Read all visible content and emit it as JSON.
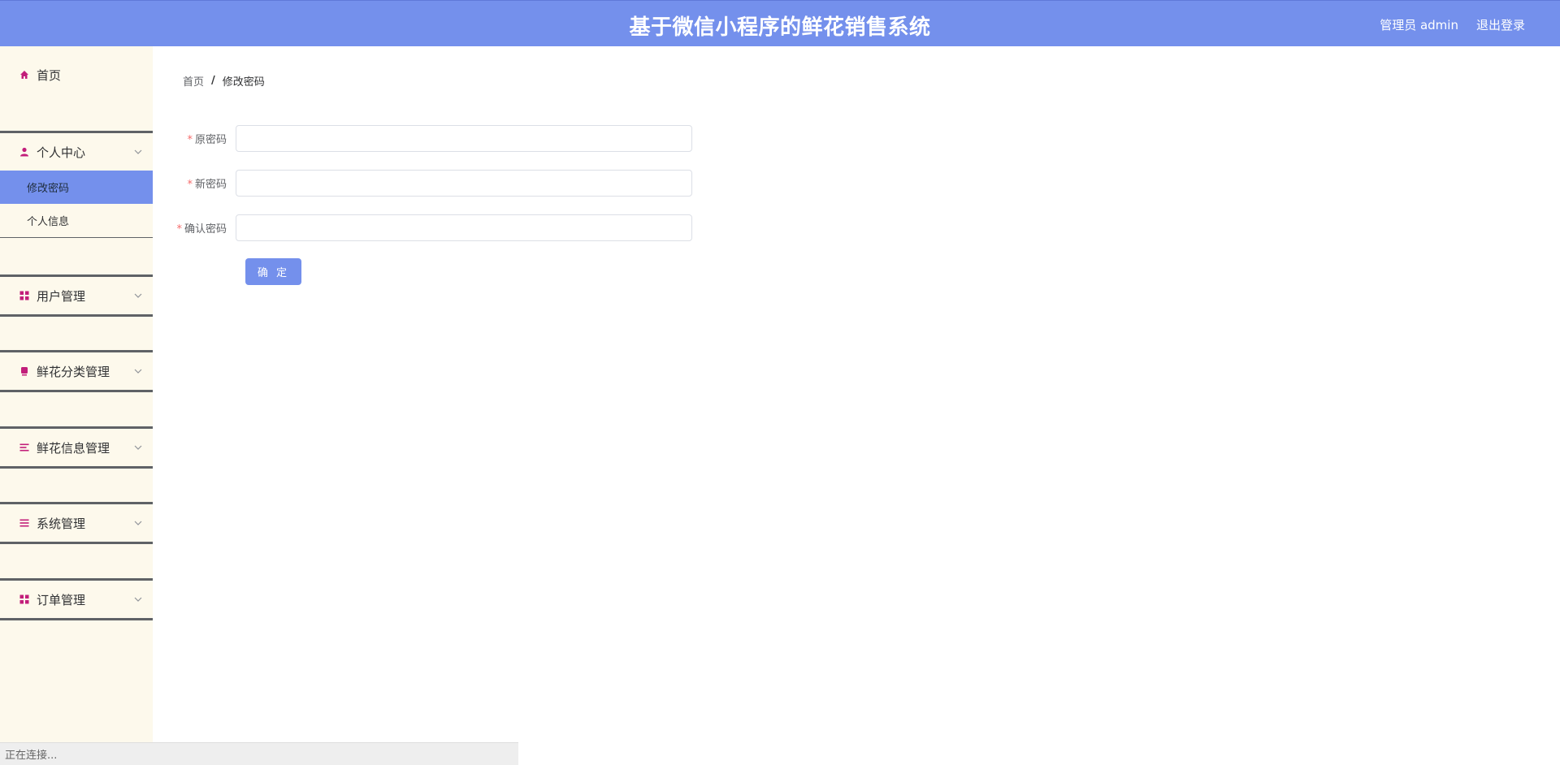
{
  "header": {
    "title": "基于微信小程序的鲜花销售系统",
    "user": "管理员 admin",
    "logout": "退出登录"
  },
  "sidebar": {
    "home": {
      "label": "首页",
      "icon": "home-icon"
    },
    "groups": [
      {
        "label": "个人中心",
        "icon": "user-icon",
        "children": [
          "修改密码",
          "个人信息"
        ]
      },
      {
        "label": "用户管理",
        "icon": "grid-icon"
      },
      {
        "label": "鲜花分类管理",
        "icon": "folder-icon"
      },
      {
        "label": "鲜花信息管理",
        "icon": "list-icon"
      },
      {
        "label": "系统管理",
        "icon": "list-icon"
      },
      {
        "label": "订单管理",
        "icon": "grid-icon"
      }
    ],
    "active_item": "修改密码"
  },
  "breadcrumb": {
    "home": "首页",
    "separator": "/",
    "current": "修改密码"
  },
  "form": {
    "fields": [
      {
        "label": "原密码",
        "value": "",
        "required": "*"
      },
      {
        "label": "新密码",
        "value": "",
        "required": "*"
      },
      {
        "label": "确认密码",
        "value": "",
        "required": "*"
      }
    ],
    "submit": "确 定"
  },
  "status": "正在连接...",
  "colors": {
    "primary": "#7490ec",
    "sidebar_bg": "#fdf9ec",
    "icon": "#c21e7a",
    "required": "#f56c6c"
  }
}
